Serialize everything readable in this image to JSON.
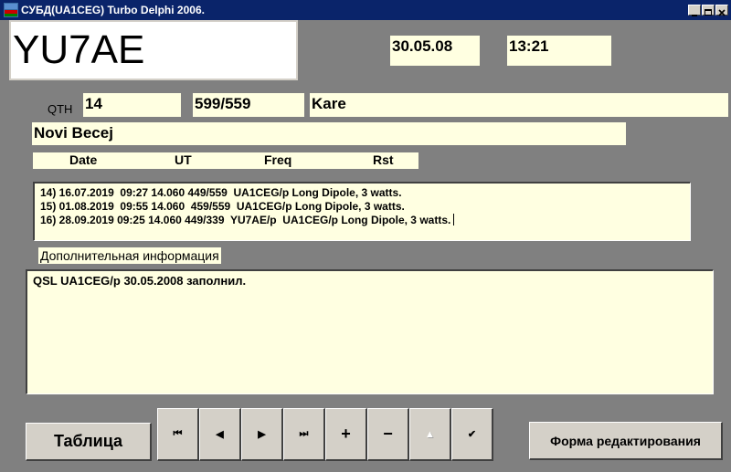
{
  "window": {
    "title": "СУБД(UA1CEG) Turbo Delphi 2006.",
    "controls": [
      "minimize-icon",
      "maximize-icon",
      "close-icon"
    ]
  },
  "form": {
    "callsign": "YU7AE",
    "date": "30.05.08",
    "time": "13:21",
    "qth_label": "QTH",
    "band": "14",
    "rst": "599/559",
    "name": "Kare",
    "qth": "Novi Becej"
  },
  "log_header": [
    "Date",
    "UT",
    "Freq",
    "Rst"
  ],
  "log_lines": [
    "14) 16.07.2019  09:27 14.060 449/559  UA1CEG/p Long Dipole, 3 watts.",
    "15) 01.08.2019  09:55 14.060  459/559  UA1CEG/p Long Dipole, 3 watts.",
    "16) 28.09.2019 09:25 14.060 449/339  YU7AE/p  UA1CEG/p Long Dipole, 3 watts."
  ],
  "extra_info_label": "Дополнительная информация",
  "extra_info_text": "QSL UA1CEG/p 30.05.2008 заполнил.",
  "buttons": {
    "table": "Таблица",
    "edit_form": "Форма редактирования"
  },
  "navigator": [
    {
      "icon": "first-record-icon",
      "glyph": "⏮",
      "enabled": true
    },
    {
      "icon": "prior-record-icon",
      "glyph": "◀",
      "enabled": true
    },
    {
      "icon": "next-record-icon",
      "glyph": "▶",
      "enabled": true
    },
    {
      "icon": "last-record-icon",
      "glyph": "⏭",
      "enabled": true
    },
    {
      "icon": "insert-record-icon",
      "glyph": "+",
      "enabled": true
    },
    {
      "icon": "delete-record-icon",
      "glyph": "−",
      "enabled": true
    },
    {
      "icon": "edit-record-icon",
      "glyph": "▲",
      "enabled": false
    },
    {
      "icon": "post-record-icon",
      "glyph": "✔",
      "enabled": true
    }
  ],
  "colors": {
    "form_bg": "#808080",
    "field_bg": "#ffffe1",
    "titlebar": "#0a246a",
    "button_face": "#d4d0c8"
  }
}
